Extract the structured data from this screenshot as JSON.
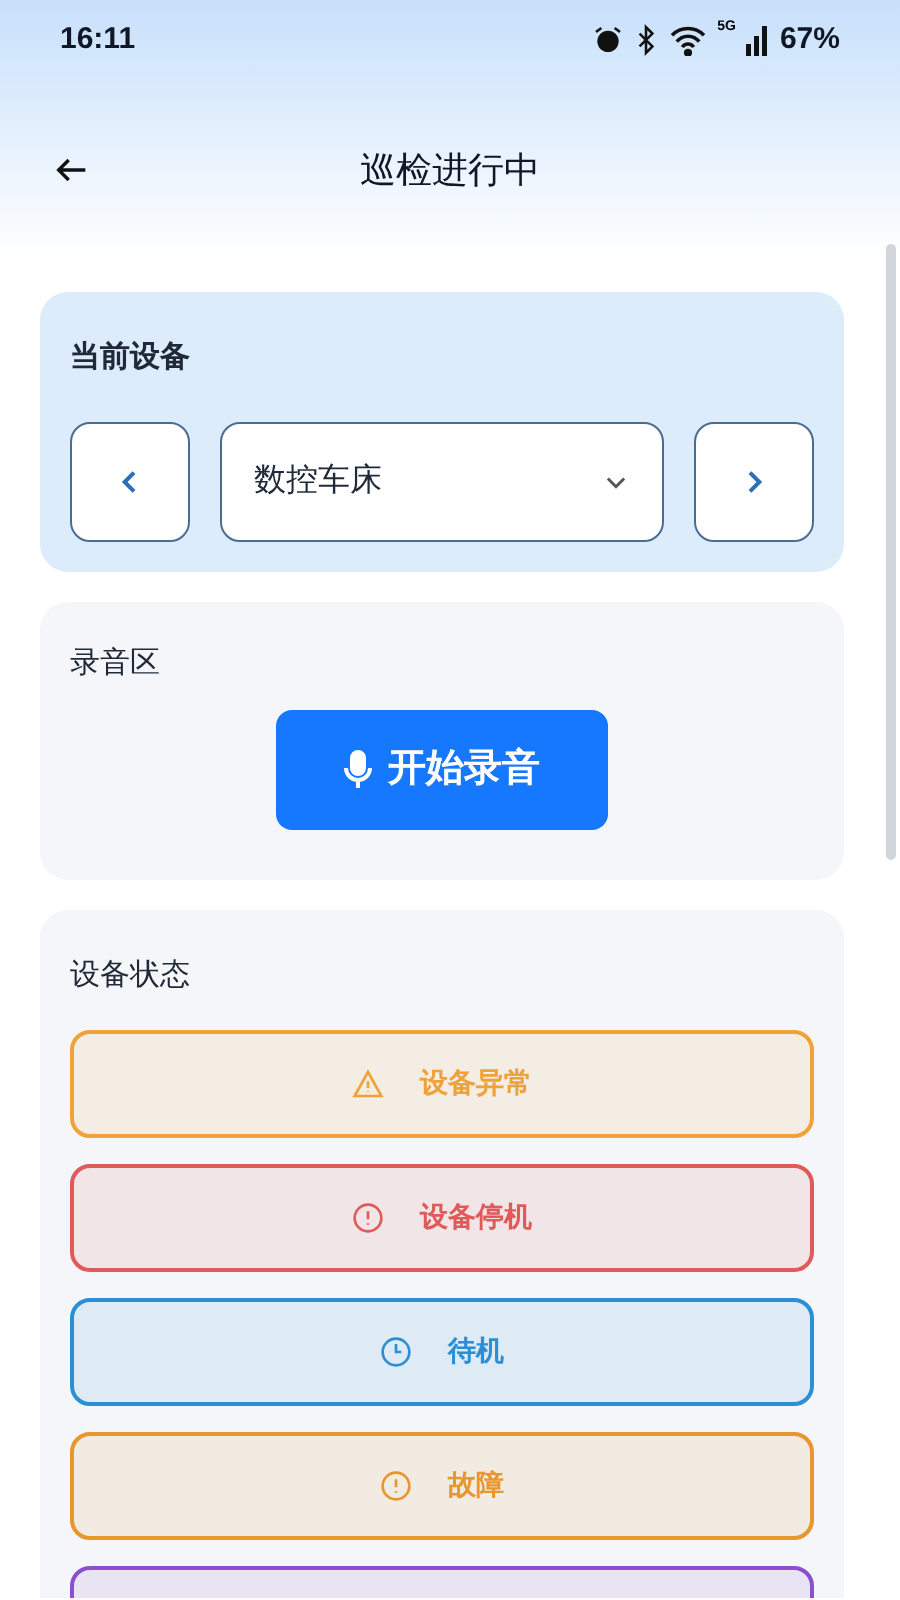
{
  "status_bar": {
    "time": "16:11",
    "network": "5G",
    "battery": "67%"
  },
  "header": {
    "title": "巡检进行中"
  },
  "current_device": {
    "title": "当前设备",
    "device": "数控车床"
  },
  "recording": {
    "title": "录音区",
    "button": "开始录音"
  },
  "device_status": {
    "title": "设备状态",
    "options": [
      {
        "label": "设备异常",
        "kind": "warning",
        "color": "#f0a23a"
      },
      {
        "label": "设备停机",
        "kind": "alert",
        "color": "#e05a5a"
      },
      {
        "label": "待机",
        "kind": "clock",
        "color": "#2b8fd6"
      },
      {
        "label": "故障",
        "kind": "alert",
        "color": "#e8962e"
      },
      {
        "kind": "none",
        "color": "#8b4fd0"
      }
    ]
  }
}
